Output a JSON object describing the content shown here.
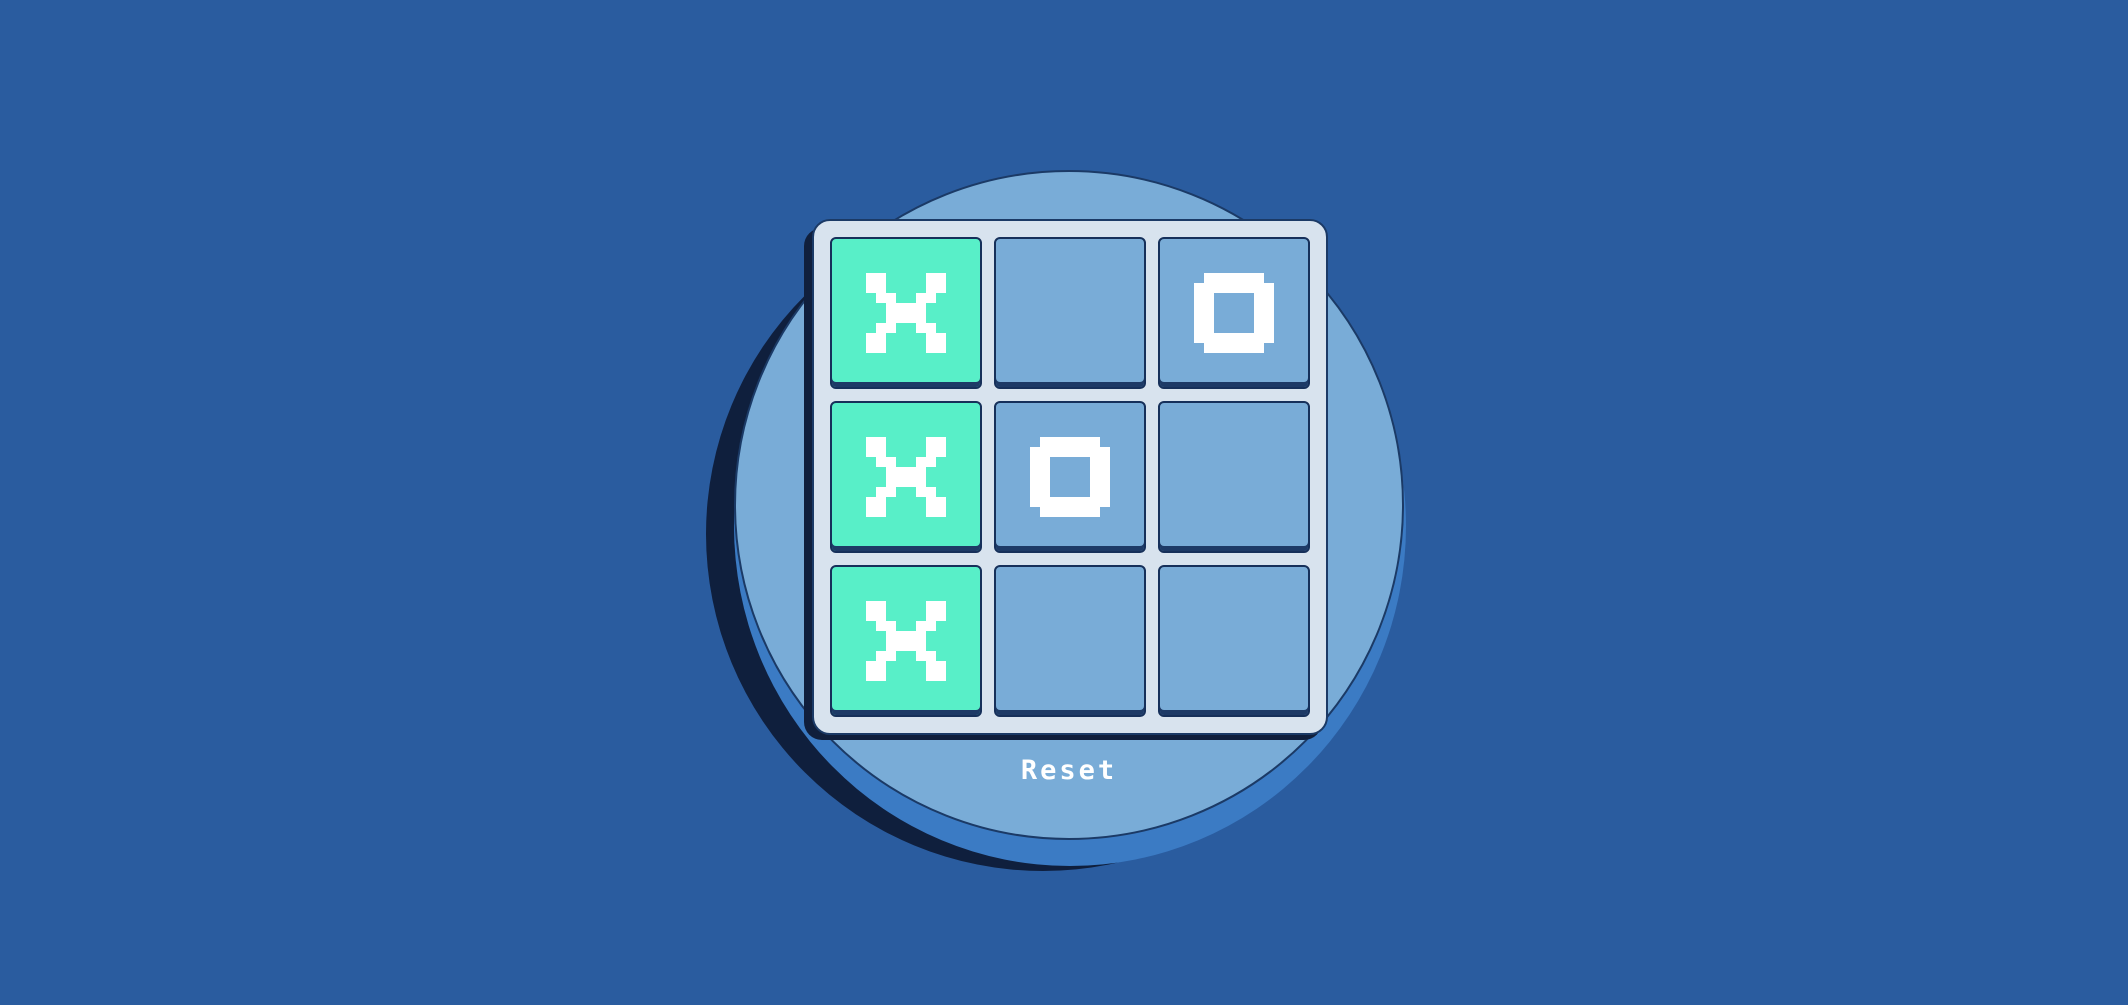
{
  "board": {
    "cells": [
      {
        "mark": "X",
        "winning": true
      },
      {
        "mark": "",
        "winning": false
      },
      {
        "mark": "O",
        "winning": false
      },
      {
        "mark": "X",
        "winning": true
      },
      {
        "mark": "O",
        "winning": false
      },
      {
        "mark": "",
        "winning": false
      },
      {
        "mark": "X",
        "winning": true
      },
      {
        "mark": "",
        "winning": false
      },
      {
        "mark": "",
        "winning": false
      }
    ]
  },
  "reset_label": "Reset",
  "colors": {
    "background": "#2a5c9f",
    "circle": "#79acd7",
    "board_frame": "#d8e3ee",
    "cell": "#79acd7",
    "winning_cell": "#58efc8",
    "mark": "#ffffff"
  }
}
